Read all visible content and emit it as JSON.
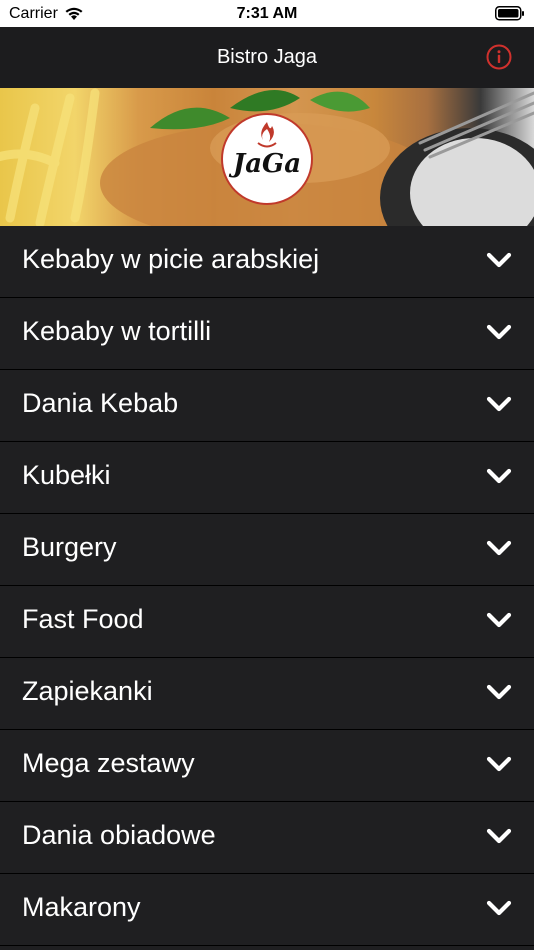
{
  "status_bar": {
    "carrier": "Carrier",
    "time": "7:31 AM"
  },
  "nav": {
    "title": "Bistro Jaga",
    "info_icon": "info-icon",
    "info_color": "#d0312d"
  },
  "banner": {
    "logo_text": "JaGa"
  },
  "menu": {
    "chevron_icon": "chevron-down-icon",
    "items": [
      {
        "label": "Kebaby w picie arabskiej"
      },
      {
        "label": "Kebaby w tortilli"
      },
      {
        "label": "Dania Kebab"
      },
      {
        "label": "Kubełki"
      },
      {
        "label": "Burgery"
      },
      {
        "label": "Fast Food"
      },
      {
        "label": "Zapiekanki"
      },
      {
        "label": "Mega zestawy"
      },
      {
        "label": "Dania obiadowe"
      },
      {
        "label": "Makarony"
      }
    ]
  }
}
